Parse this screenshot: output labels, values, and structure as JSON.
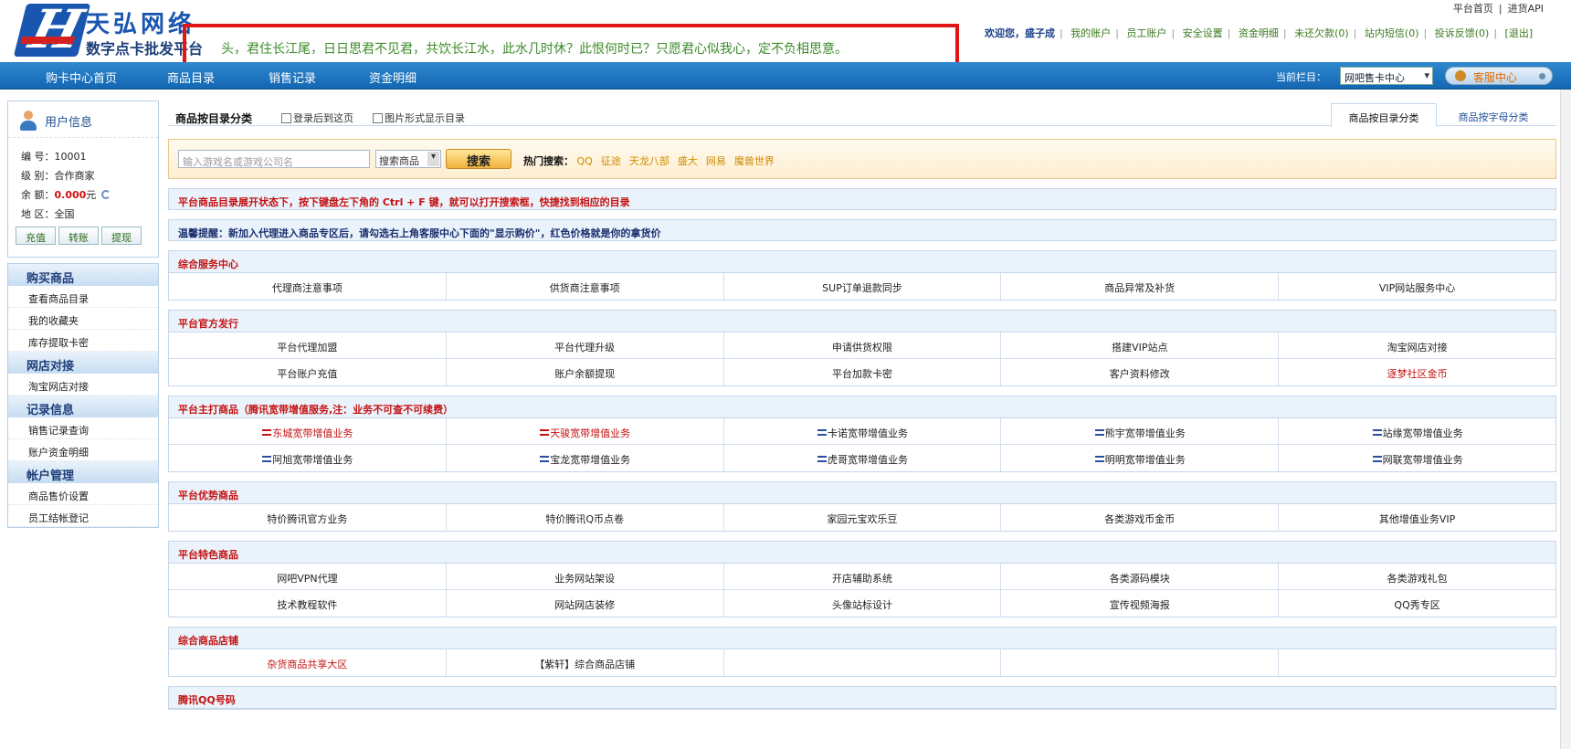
{
  "header": {
    "logo_title": "天弘网络",
    "logo_sub": "数字点卡批发平台",
    "marquee": "头，君住长江尾，日日思君不见君，共饮长江水，此水几时休？此恨何时已？只愿君心似我心，定不负相思意。",
    "top_links": [
      "平台首页",
      "进货API"
    ],
    "welcome": "欢迎您，盛子成",
    "user_links": [
      "我的账户",
      "员工账户",
      "安全设置",
      "资金明细",
      "未还欠款(0)",
      "站内短信(0)",
      "投诉反馈(0)",
      "[退出]"
    ]
  },
  "nav": {
    "items": [
      "购卡中心首页",
      "商品目录",
      "销售记录",
      "资金明细"
    ],
    "current_label": "当前栏目：",
    "current_select": "网吧售卡中心",
    "service": "客服中心"
  },
  "user_info": {
    "title": "用户信息",
    "id": "编 号：10001",
    "level": "级 别：合作商家",
    "balance_label": "余 额：",
    "balance": "0.000",
    "balance_unit": "元",
    "region": "地 区：全国",
    "buttons": [
      "充值",
      "转账",
      "提现"
    ]
  },
  "menu": [
    {
      "head": "购买商品",
      "items": [
        "查看商品目录",
        "我的收藏夹",
        "库存提取卡密"
      ]
    },
    {
      "head": "网店对接",
      "items": [
        "淘宝网店对接"
      ]
    },
    {
      "head": "记录信息",
      "items": [
        "销售记录查询",
        "账户资金明细"
      ]
    },
    {
      "head": "帐户管理",
      "items": [
        "商品售价设置",
        "员工结帐登记"
      ]
    }
  ],
  "main": {
    "title": "商品按目录分类",
    "check1": "登录后到这页",
    "check2": "图片形式显示目录",
    "tab_cat": "商品按目录分类",
    "tab_alpha": "商品按字母分类",
    "search_placeholder": "输入游戏名或游戏公司名",
    "search_select": "搜索商品",
    "search_btn": "搜索",
    "hot_label": "热门搜索：",
    "hot": [
      "QQ",
      "征途",
      "天龙八部",
      "盛大",
      "网易",
      "魔兽世界"
    ],
    "notice1": "平台商品目录展开状态下，按下键盘左下角的 Ctrl + F 键，就可以打开搜索框，快捷找到相应的目录",
    "notice2": "温馨提醒：新加入代理进入商品专区后，请勾选右上角客服中心下面的\"显示购价\"，红色价格就是你的拿货价"
  },
  "sections": [
    {
      "title": "综合服务中心",
      "rows": [
        [
          "代理商注意事项",
          "供货商注意事项",
          "SUP订单退款同步",
          "商品异常及补货",
          "VIP网站服务中心"
        ]
      ]
    },
    {
      "title": "平台官方发行",
      "rows": [
        [
          "平台代理加盟",
          "平台代理升级",
          "申请供货权限",
          "搭建VIP站点",
          "淘宝网店对接"
        ],
        [
          "平台账户充值",
          "账户余额提现",
          "平台加款卡密",
          "客户资料修改",
          "逐梦社区金币"
        ]
      ]
    },
    {
      "title": "平台主打商品（腾讯宽带增值服务,注：业务不可查不可续费）",
      "rows": [
        [
          "东城宽带增值业务",
          "天骏宽带增值业务",
          "卡诺宽带增值业务",
          "熊宇宽带增值业务",
          "站缘宽带增值业务"
        ],
        [
          "阿旭宽带增值业务",
          "宝龙宽带增值业务",
          "虎哥宽带增值业务",
          "明明宽带增值业务",
          "网联宽带增值业务"
        ]
      ]
    },
    {
      "title": "平台优势商品",
      "rows": [
        [
          "特价腾讯官方业务",
          "特价腾讯Q币点卷",
          "家园元宝欢乐豆",
          "各类游戏币金币",
          "其他增值业务VIP"
        ]
      ]
    },
    {
      "title": "平台特色商品",
      "rows": [
        [
          "网吧VPN代理",
          "业务网站架设",
          "开店辅助系统",
          "各类源码模块",
          "各类游戏礼包"
        ],
        [
          "技术教程软件",
          "网站网店装修",
          "头像站标设计",
          "宣传视频海报",
          "QQ秀专区"
        ]
      ]
    },
    {
      "title": "综合商品店铺",
      "rows": [
        [
          "杂货商品共享大区",
          "【紫轩】综合商品店铺",
          "",
          "",
          ""
        ]
      ]
    },
    {
      "title": "腾讯QQ号码",
      "rows": []
    }
  ],
  "colors": {
    "nav": "#1467b3",
    "accent_red": "#c41212",
    "link_green": "#3a7a1e",
    "marquee_border": "#e01515"
  }
}
